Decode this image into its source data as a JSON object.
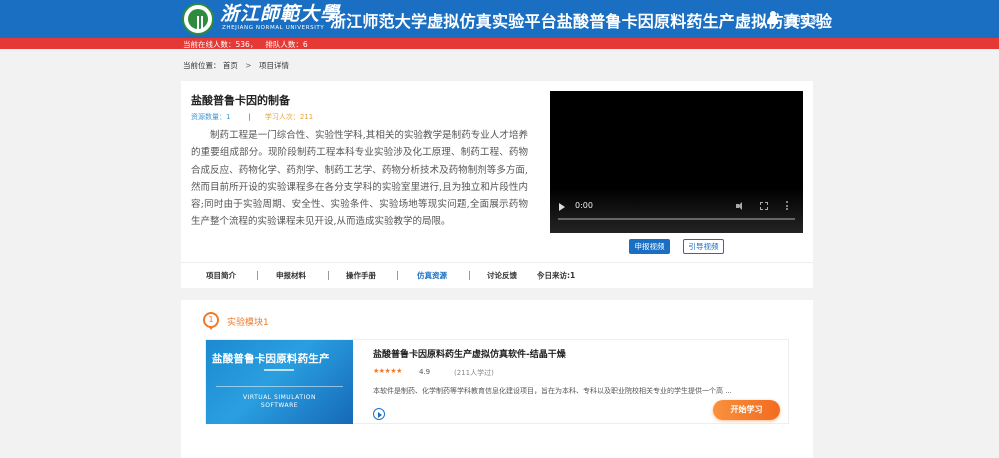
{
  "header": {
    "university_name": "浙江師範大學",
    "university_en": "ZHEJIANG NORMAL UNIVERSITY",
    "site_title": "浙江师范大学虚拟仿真实验平台盐酸普鲁卡因原料药生产虚拟仿真实验",
    "user_label": "评审专家"
  },
  "status_bar": {
    "online": "当前在线人数：536，",
    "queue": "排队人数：6"
  },
  "breadcrumb": {
    "prefix": "当前位置：",
    "home": "首页",
    "separator": ">",
    "current": "项目详情"
  },
  "project": {
    "title": "盐酸普鲁卡因的制备",
    "resources": "资源数量：1",
    "divider": "|",
    "learners": "学习人次：211",
    "description": "制药工程是一门综合性、实验性学科,其相关的实验教学是制药专业人才培养的重要组成部分。现阶段制药工程本科专业实验涉及化工原理、制药工程、药物合成反应、药物化学、药剂学、制药工艺学、药物分析技术及药物制剂等多方面,然而目前所开设的实验课程多在各分支学科的实验室里进行,且为独立和片段性内容;同时由于实验周期、安全性、实验条件、实验场地等现实问题,全面展示药物生产整个流程的实验课程未见开设,从而造成实验教学的局限。",
    "video_time": "0:00",
    "apply_video": "申报视频",
    "guide_video": "引导视频"
  },
  "tabs": [
    {
      "label": "项目简介"
    },
    {
      "label": "申报材料"
    },
    {
      "label": "操作手册"
    },
    {
      "label": "仿真资源"
    },
    {
      "label": "讨论反馈"
    },
    {
      "label": "今日来访:1"
    }
  ],
  "active_tab_index": 3,
  "module": {
    "number": "1",
    "label": "实验模块1",
    "thumb_title": "盐酸普鲁卡因原料药生产",
    "thumb_en_1": "VIRTUAL SIMULATION",
    "thumb_en_2": "SOFTWARE",
    "software_title": "盐酸普鲁卡因原料药生产虚拟仿真软件-结晶干燥",
    "stars": "★★★★★",
    "rating": "4.9",
    "visits": "(211人学过)",
    "description": "本软件是制药、化学制药等学科教育信息化建设项目，旨在为本科、专科以及职业院校相关专业的学生提供一个高 ...",
    "start_button": "开始学习"
  },
  "colors": {
    "header_blue": "#1a6fc3",
    "status_red": "#e53935",
    "accent_orange": "#f07a28",
    "logo_green": "#2e8b3d"
  },
  "icons": [
    "university-logo-icon",
    "user-icon",
    "play-icon",
    "volume-icon",
    "fullscreen-icon",
    "more-options-icon",
    "location-pin-icon",
    "play-circle-icon"
  ]
}
